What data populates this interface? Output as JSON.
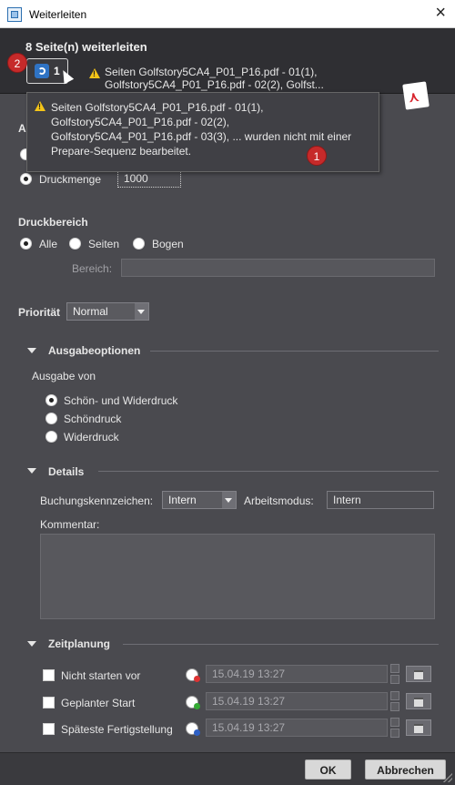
{
  "window": {
    "title": "Weiterleiten"
  },
  "header": {
    "heading": "8 Seite(n) weiterleiten",
    "badge_2": "2",
    "sequence_count": "1",
    "warning_line1": "Seiten Golfstory5CA4_P01_P16.pdf - 01(1),",
    "warning_line2": "Golfstory5CA4_P01_P16.pdf - 02(2), Golfst..."
  },
  "tooltip": {
    "line1": "Seiten Golfstory5CA4_P01_P16.pdf - 01(1),",
    "line2": "Golfstory5CA4_P01_P16.pdf - 02(2),",
    "line3": "Golfstory5CA4_P01_P16.pdf - 03(3), ... wurden nicht mit einer",
    "line4": "Prepare-Sequenz bearbeitet.",
    "badge_1": "1"
  },
  "quantity": {
    "partial_label": "A",
    "label": "Druckmenge",
    "value": "1000"
  },
  "print_range": {
    "heading": "Druckbereich",
    "options": [
      "Alle",
      "Seiten",
      "Bogen"
    ],
    "selected": "Alle",
    "range_label": "Bereich:",
    "range_value": ""
  },
  "priority": {
    "label": "Priorität",
    "value": "Normal"
  },
  "output_options": {
    "heading": "Ausgabeoptionen",
    "output_from_label": "Ausgabe von",
    "options": [
      "Schön- und Widerdruck",
      "Schöndruck",
      "Widerdruck"
    ],
    "selected": "Schön- und Widerdruck"
  },
  "details": {
    "heading": "Details",
    "booking_label": "Buchungskennzeichen:",
    "booking_value": "Intern",
    "work_mode_label": "Arbeitsmodus:",
    "work_mode_value": "Intern",
    "comment_label": "Kommentar:",
    "comment_value": ""
  },
  "scheduling": {
    "heading": "Zeitplanung",
    "rows": [
      {
        "label": "Nicht starten vor",
        "value": "15.04.19 13:27",
        "icon": "clock-red-icon"
      },
      {
        "label": "Geplanter Start",
        "value": "15.04.19 13:27",
        "icon": "clock-green-icon"
      },
      {
        "label": "Späteste Fertigstellung",
        "value": "15.04.19 13:27",
        "icon": "clock-blue-icon"
      }
    ]
  },
  "footer": {
    "ok": "OK",
    "cancel": "Abbrechen"
  },
  "colors": {
    "background": "#4a4a4f",
    "header": "#2f2f33",
    "badge": "#c62a2a",
    "warning": "#f5c518",
    "pdf_red": "#d8262f"
  }
}
